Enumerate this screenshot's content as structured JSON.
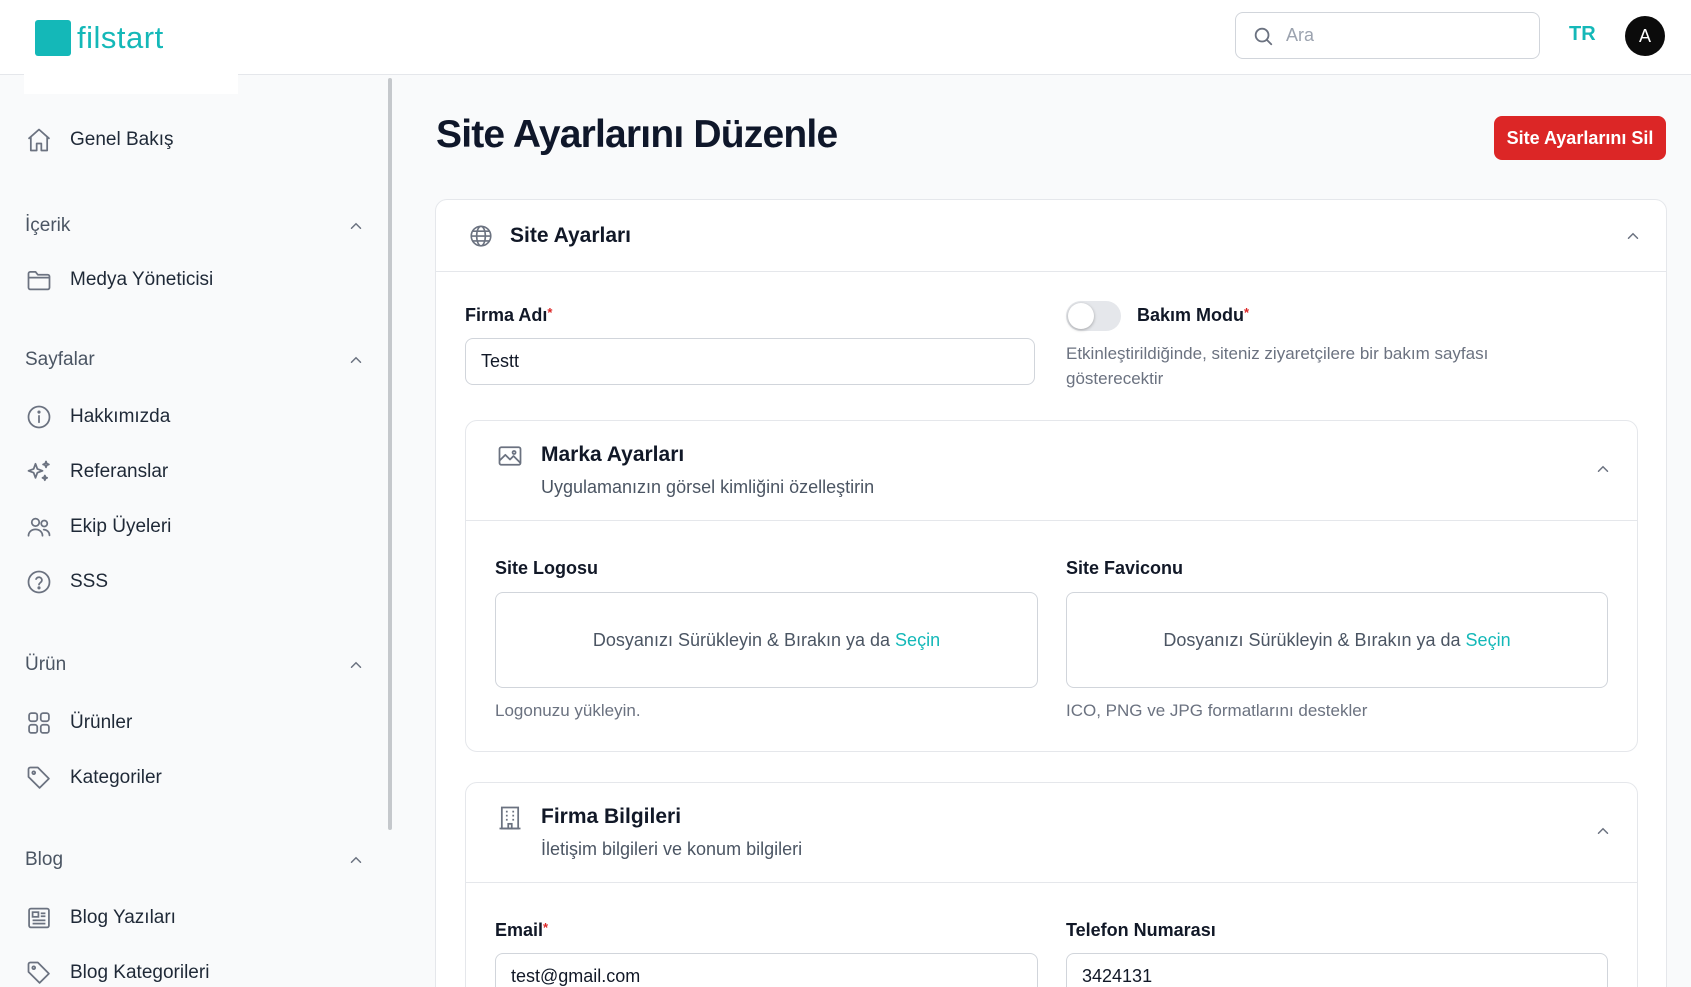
{
  "header": {
    "logo_text": "filstart",
    "search_placeholder": "Ara",
    "language": "TR",
    "avatar_initial": "A"
  },
  "sidebar": {
    "overview": "Genel Bakış",
    "groups": {
      "content": {
        "label": "İçerik",
        "items": [
          "Medya Yöneticisi"
        ]
      },
      "pages": {
        "label": "Sayfalar",
        "items": [
          "Hakkımızda",
          "Referanslar",
          "Ekip Üyeleri",
          "SSS"
        ]
      },
      "product": {
        "label": "Ürün",
        "items": [
          "Ürünler",
          "Kategoriler"
        ]
      },
      "blog": {
        "label": "Blog",
        "items": [
          "Blog Yazıları",
          "Blog Kategorileri"
        ]
      }
    }
  },
  "page": {
    "title": "Site Ayarlarını Düzenle",
    "delete_button": "Site Ayarlarını Sil"
  },
  "site_settings": {
    "title": "Site Ayarları",
    "company_name": {
      "label": "Firma Adı",
      "required": "*",
      "value": "Testt"
    },
    "maintenance": {
      "label": "Bakım Modu",
      "required": "*",
      "enabled": false,
      "help": "Etkinleştirildiğinde, siteniz ziyaretçilere bir bakım sayfası gösterecektir"
    }
  },
  "brand_settings": {
    "title": "Marka Ayarları",
    "description": "Uygulamanızın görsel kimliğini özelleştirin",
    "logo": {
      "label": "Site Logosu",
      "drop_text": "Dosyanızı Sürükleyin & Bırakın ya da",
      "pick_text": "Seçin",
      "help": "Logonuzu yükleyin."
    },
    "favicon": {
      "label": "Site Faviconu",
      "drop_text": "Dosyanızı Sürükleyin & Bırakın ya da",
      "pick_text": "Seçin",
      "help": "ICO, PNG ve JPG formatlarını destekler"
    }
  },
  "company_info": {
    "title": "Firma Bilgileri",
    "description": "İletişim bilgileri ve konum bilgileri",
    "email": {
      "label": "Email",
      "required": "*",
      "value": "test@gmail.com"
    },
    "phone": {
      "label": "Telefon Numarası",
      "value": "3424131"
    }
  },
  "colors": {
    "brand": "#14b8b8",
    "danger": "#dc2626",
    "text": "#111827",
    "muted": "#6b7280",
    "border": "#e5e7eb"
  }
}
